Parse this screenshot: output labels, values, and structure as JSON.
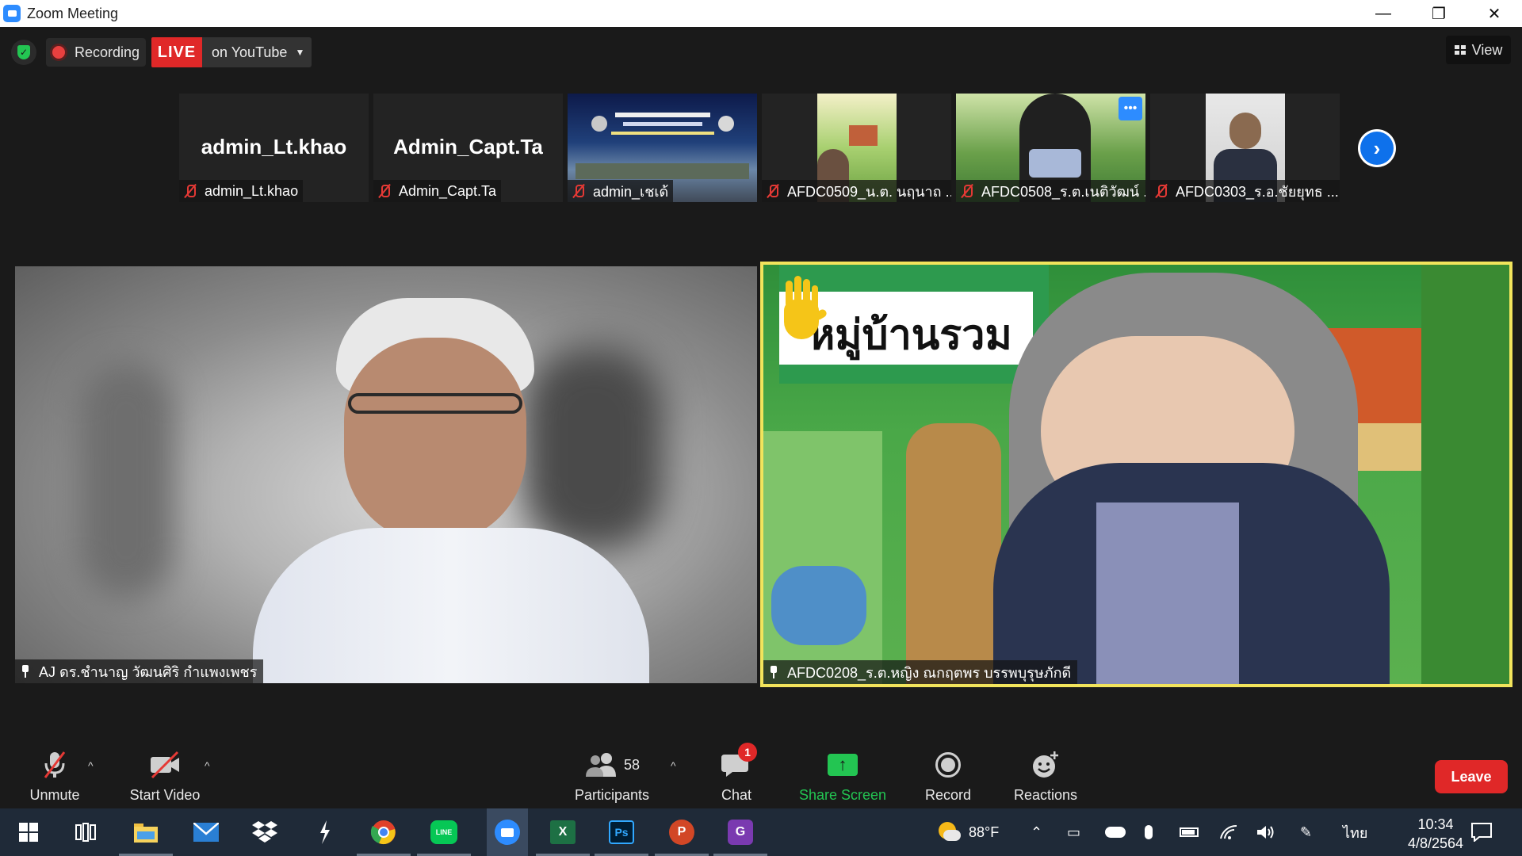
{
  "window": {
    "title": "Zoom Meeting",
    "minimize": "—",
    "maximize": "❐",
    "close": "✕"
  },
  "status": {
    "recording_label": "Recording",
    "live_badge": "LIVE",
    "live_target": "on YouTube",
    "view_label": "View"
  },
  "thumbnails": [
    {
      "big_name": "admin_Lt.khao",
      "caption": "admin_Lt.khao"
    },
    {
      "big_name": "Admin_Capt.Ta",
      "caption": "Admin_Capt.Ta"
    },
    {
      "big_name": "",
      "caption": "admin_เชเด้"
    },
    {
      "big_name": "",
      "caption": "AFDC0509_น.ต. นฤนาถ ..."
    },
    {
      "big_name": "",
      "caption": "AFDC0508_ร.ต.เนติวัฒน์ ..."
    },
    {
      "big_name": "",
      "caption": "AFDC0303_ร.อ.ชัยยุทธ ..."
    }
  ],
  "videos": {
    "left_name": "AJ ดร.ชำนาญ วัฒนศิริ กำแพงเพชร",
    "right_name": "AFDC0208_ร.ต.หญิง ณกฤตพร บรรพบุรุษภักดี",
    "right_banner_text": "หมู่บ้านรวม"
  },
  "toolbar": {
    "unmute": "Unmute",
    "start_video": "Start Video",
    "participants": "Participants",
    "participants_count": "58",
    "chat": "Chat",
    "chat_badge": "1",
    "share_screen": "Share Screen",
    "record": "Record",
    "reactions": "Reactions",
    "leave": "Leave"
  },
  "taskbar": {
    "weather": "88°F",
    "language": "ไทย",
    "time": "10:34",
    "date": "4/8/2564"
  },
  "colors": {
    "live_red": "#e02828",
    "zoom_blue": "#0e71eb",
    "share_green": "#23c552",
    "active_speaker_border": "#f2e45c"
  }
}
